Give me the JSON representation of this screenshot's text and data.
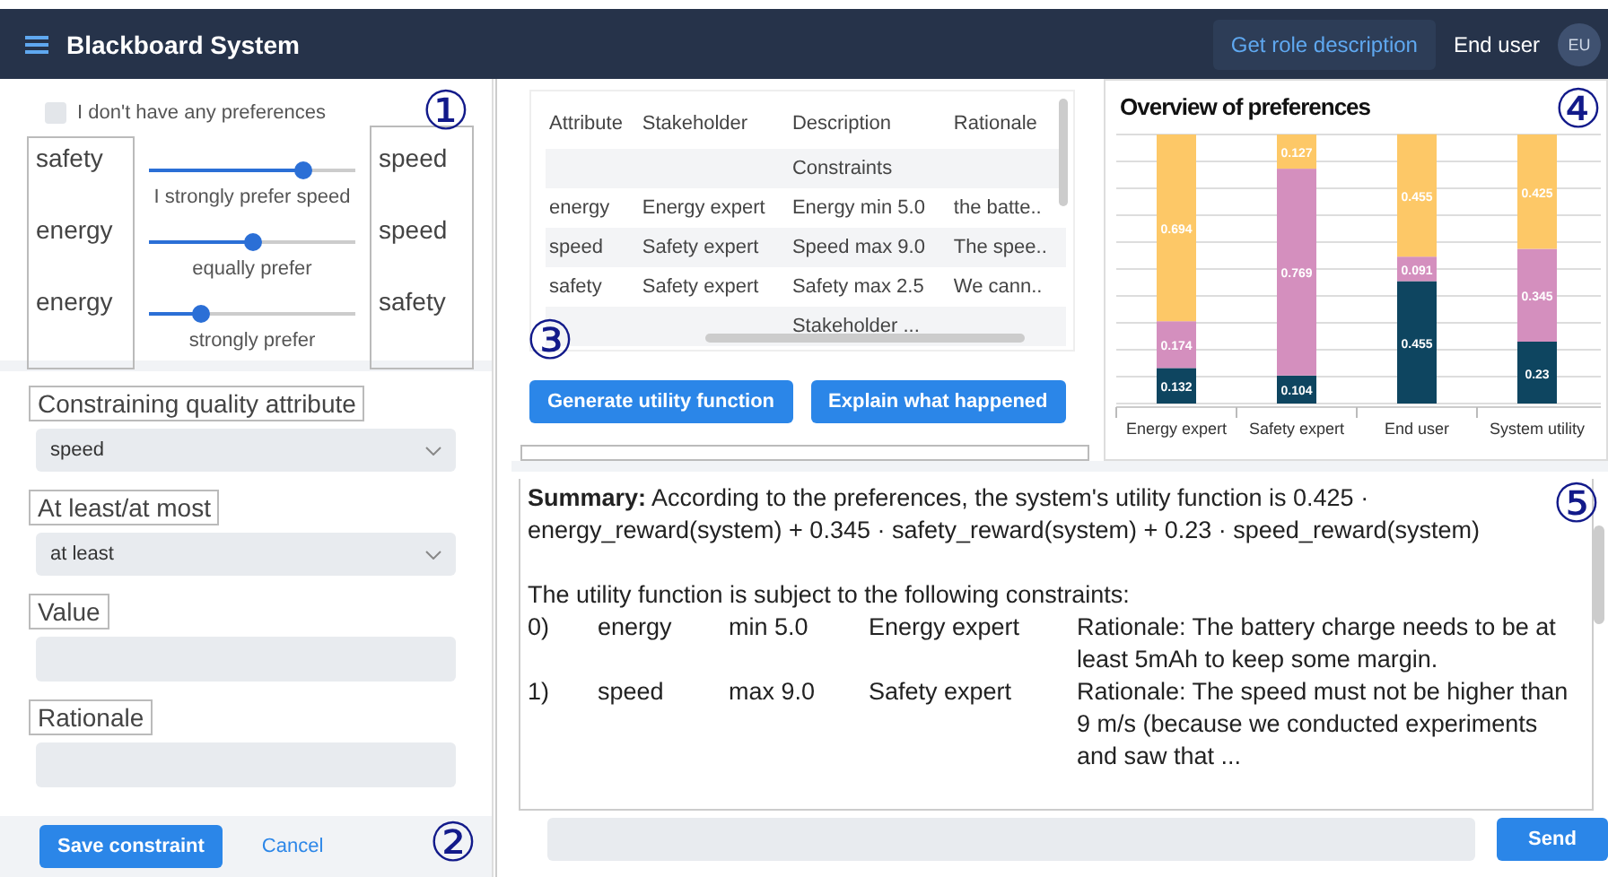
{
  "header": {
    "title": "Blackboard System",
    "role_button": "Get role description",
    "user_name": "End user",
    "avatar": "EU"
  },
  "preferences": {
    "no_preferences": {
      "label": "I don't have any preferences",
      "checked": false
    },
    "marker": "①",
    "sliders": [
      {
        "left": "safety",
        "right": "speed",
        "caption": "I strongly prefer speed",
        "level": 0.75
      },
      {
        "left": "energy",
        "right": "speed",
        "caption": "equally prefer",
        "level": 0.5
      },
      {
        "left": "energy",
        "right": "safety",
        "caption": "strongly prefer",
        "level": 0.25
      }
    ]
  },
  "constraint_form": {
    "fields": [
      {
        "kind": "select",
        "label": "Constraining quality attribute",
        "value": "speed"
      },
      {
        "kind": "select",
        "label": "At least/at most",
        "value": "at least"
      },
      {
        "kind": "input",
        "label": "Value"
      },
      {
        "kind": "input",
        "label": "Rationale"
      }
    ],
    "save_button": "Save constraint",
    "cancel_link": "Cancel",
    "marker": "②"
  },
  "table": {
    "columns": [
      "Attribute",
      "Stakeholder",
      "Description",
      "Rationale"
    ],
    "rows": [
      [
        "",
        "",
        "Constraints",
        ""
      ],
      [
        "energy",
        "Energy expert",
        "Energy min 5.0",
        "the batte.."
      ],
      [
        "speed",
        "Safety expert",
        "Speed max 9.0",
        "The spee.."
      ],
      [
        "safety",
        "Safety expert",
        "Safety max 2.5",
        "We cann.."
      ],
      [
        "",
        "",
        "Stakeholder ...",
        ""
      ]
    ],
    "marker": "③"
  },
  "actions": [
    "Generate utility function",
    "Explain what happened"
  ],
  "chart": {
    "marker": "④",
    "chart_data": {
      "type": "bar",
      "title": "Overview of preferences",
      "stacked": true,
      "data_labels": true,
      "ylim": [
        0,
        1
      ],
      "categories": [
        "Energy expert",
        "Safety expert",
        "End user",
        "System utility"
      ],
      "series": [
        {
          "color": "#0e4560",
          "values": [
            0.132,
            0.104,
            0.455,
            0.23
          ]
        },
        {
          "color": "#d48fbe",
          "values": [
            0.174,
            0.769,
            0.091,
            0.345
          ]
        },
        {
          "color": "#fdc867",
          "values": [
            0.694,
            0.127,
            0.455,
            0.425
          ]
        }
      ]
    }
  },
  "summary": {
    "marker": "⑤",
    "text": "**Summary:** According to the preferences, the system's utility function is 0.425 · energy_reward(system) + 0.345 · safety_reward(system) + 0.23 · speed_reward(system)",
    "constraints_intro": "The utility function is subject to the following constraints:",
    "constraints": [
      {
        "index": "0)",
        "attribute": "energy",
        "bound": "min 5.0",
        "stakeholder": "Energy expert",
        "rationale": "Rationale: The battery charge needs to be at least 5mAh to keep some margin."
      },
      {
        "index": "1)",
        "attribute": "speed",
        "bound": "max 9.0",
        "stakeholder": "Safety expert",
        "rationale": "Rationale: The speed must not be higher than 9 m/s (because we conducted experiments and saw that ..."
      }
    ]
  },
  "chat": {
    "send_button": "Send"
  }
}
